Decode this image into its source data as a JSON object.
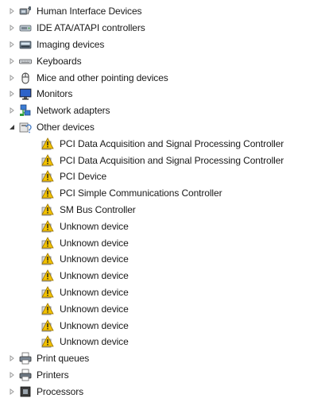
{
  "tree": {
    "categories_top": [
      {
        "label": "Human Interface Devices",
        "icon": "human-interface-devices-icon",
        "expanded": false
      },
      {
        "label": "IDE ATA/ATAPI controllers",
        "icon": "ide-controller-icon",
        "expanded": false
      },
      {
        "label": "Imaging devices",
        "icon": "imaging-devices-icon",
        "expanded": false
      },
      {
        "label": "Keyboards",
        "icon": "keyboard-icon",
        "expanded": false
      },
      {
        "label": "Mice and other pointing devices",
        "icon": "mouse-icon",
        "expanded": false
      },
      {
        "label": "Monitors",
        "icon": "monitor-icon",
        "expanded": false
      },
      {
        "label": "Network adapters",
        "icon": "network-adapter-icon",
        "expanded": false
      }
    ],
    "other_devices": {
      "label": "Other devices",
      "icon": "other-devices-icon",
      "expanded": true,
      "children": [
        {
          "label": "PCI Data Acquisition and Signal Processing Controller",
          "icon": "unknown-device-warning-icon"
        },
        {
          "label": "PCI Data Acquisition and Signal Processing Controller",
          "icon": "unknown-device-warning-icon"
        },
        {
          "label": "PCI Device",
          "icon": "unknown-device-warning-icon"
        },
        {
          "label": "PCI Simple Communications Controller",
          "icon": "unknown-device-warning-icon"
        },
        {
          "label": "SM Bus Controller",
          "icon": "unknown-device-warning-icon"
        },
        {
          "label": "Unknown device",
          "icon": "unknown-device-warning-icon"
        },
        {
          "label": "Unknown device",
          "icon": "unknown-device-warning-icon"
        },
        {
          "label": "Unknown device",
          "icon": "unknown-device-warning-icon"
        },
        {
          "label": "Unknown device",
          "icon": "unknown-device-warning-icon"
        },
        {
          "label": "Unknown device",
          "icon": "unknown-device-warning-icon"
        },
        {
          "label": "Unknown device",
          "icon": "unknown-device-warning-icon"
        },
        {
          "label": "Unknown device",
          "icon": "unknown-device-warning-icon"
        },
        {
          "label": "Unknown device",
          "icon": "unknown-device-warning-icon"
        }
      ]
    },
    "categories_bottom": [
      {
        "label": "Print queues",
        "icon": "print-queue-icon",
        "expanded": false
      },
      {
        "label": "Printers",
        "icon": "printer-icon",
        "expanded": false
      },
      {
        "label": "Processors",
        "icon": "processor-icon",
        "expanded": false
      }
    ]
  },
  "colors": {
    "text": "#1a1a1a",
    "expander": "#9a9a9a",
    "expander_open": "#3a3a3a",
    "warning": "#e8b400"
  }
}
